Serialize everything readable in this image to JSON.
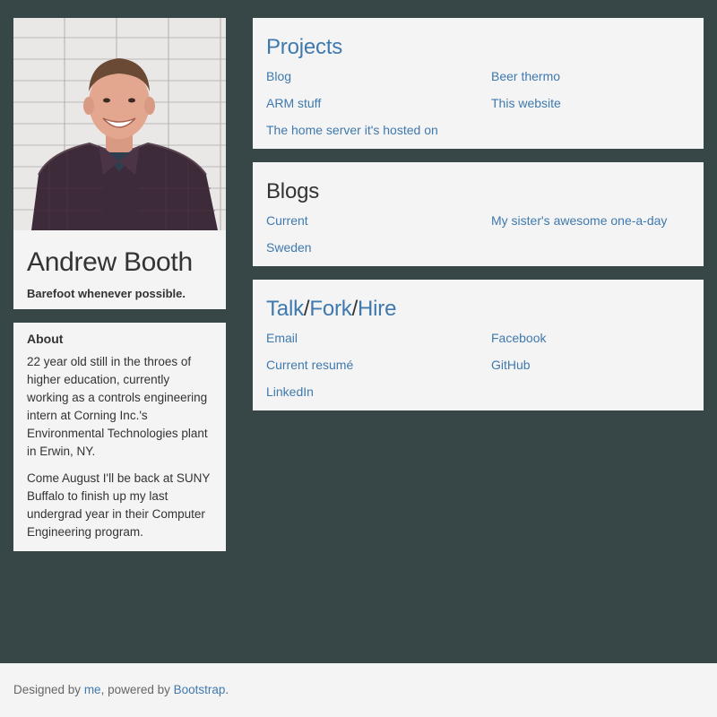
{
  "profile": {
    "name": "Andrew Booth",
    "tagline": "Barefoot whenever possible."
  },
  "about": {
    "heading": "About",
    "paragraphs": [
      "22 year old still in the throes of higher education, currently working as a controls engineering intern at Corning Inc.'s Environmental Technologies plant in Erwin, NY.",
      "Come August I'll be back at SUNY Buffalo to finish up my last undergrad year in their Computer Engineering program."
    ]
  },
  "projects": {
    "heading": "Projects",
    "links": [
      "Blog",
      "Beer thermo",
      "ARM stuff",
      "This website",
      "The home server it's hosted on"
    ]
  },
  "blogs": {
    "heading": "Blogs",
    "links": [
      "Current",
      "My sister's awesome one-a-day",
      "Sweden"
    ]
  },
  "contact": {
    "heading_parts": [
      "Talk",
      "/",
      "Fork",
      "/",
      "Hire"
    ],
    "links": [
      "Email",
      "Facebook",
      "Current resumé",
      "GitHub",
      "LinkedIn"
    ]
  },
  "footer": {
    "prefix": "Designed by ",
    "me_link": "me",
    "middle": ", powered by ",
    "bootstrap_link": "Bootstrap",
    "suffix": "."
  },
  "colors": {
    "background": "#374748",
    "panel": "#f4f4f4",
    "link": "#3f79ad"
  }
}
